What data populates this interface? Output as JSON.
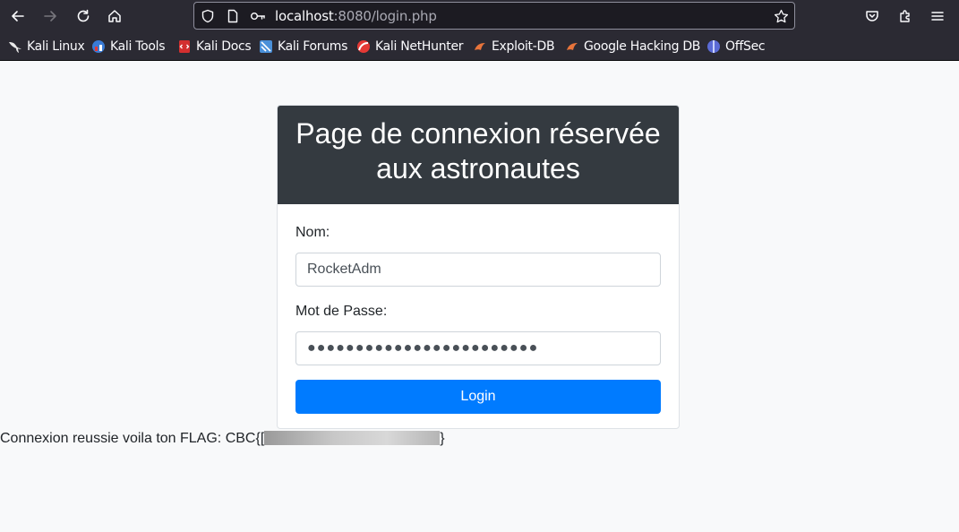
{
  "browser": {
    "url_host": "localhost",
    "url_rest": ":8080/login.php",
    "bookmarks": [
      {
        "label": "Kali Linux",
        "icon": "kali-dragon-icon",
        "color": "#ffffff"
      },
      {
        "label": "Kali Tools",
        "icon": "kali-tools-icon",
        "color": "#3a7bd5"
      },
      {
        "label": "Kali Docs",
        "icon": "kali-docs-icon",
        "color": "#d32f2f"
      },
      {
        "label": "Kali Forums",
        "icon": "kali-forums-icon",
        "color": "#4a90d9"
      },
      {
        "label": "Kali NetHunter",
        "icon": "kali-nethunter-icon",
        "color": "#e53935"
      },
      {
        "label": "Exploit-DB",
        "icon": "exploit-db-icon",
        "color": "#e8743b"
      },
      {
        "label": "Google Hacking DB",
        "icon": "ghdb-icon",
        "color": "#e8743b"
      },
      {
        "label": "OffSec",
        "icon": "offsec-icon",
        "color": "#5b6bd6"
      }
    ]
  },
  "page": {
    "title": "Page de connexion réservée aux astronautes",
    "username_label": "Nom:",
    "username_value": "RocketAdm",
    "password_label": "Mot de Passe:",
    "password_value": "●●●●●●●●●●●●●●●●●●●●●●●●",
    "login_button": "Login",
    "flag_prefix": "Connexion reussie voila ton FLAG: CBC{",
    "flag_partial": "[",
    "flag_suffix": "}"
  },
  "colors": {
    "header_bg": "#343a40",
    "button_bg": "#007bff",
    "chrome_bg": "#2b2a33"
  }
}
